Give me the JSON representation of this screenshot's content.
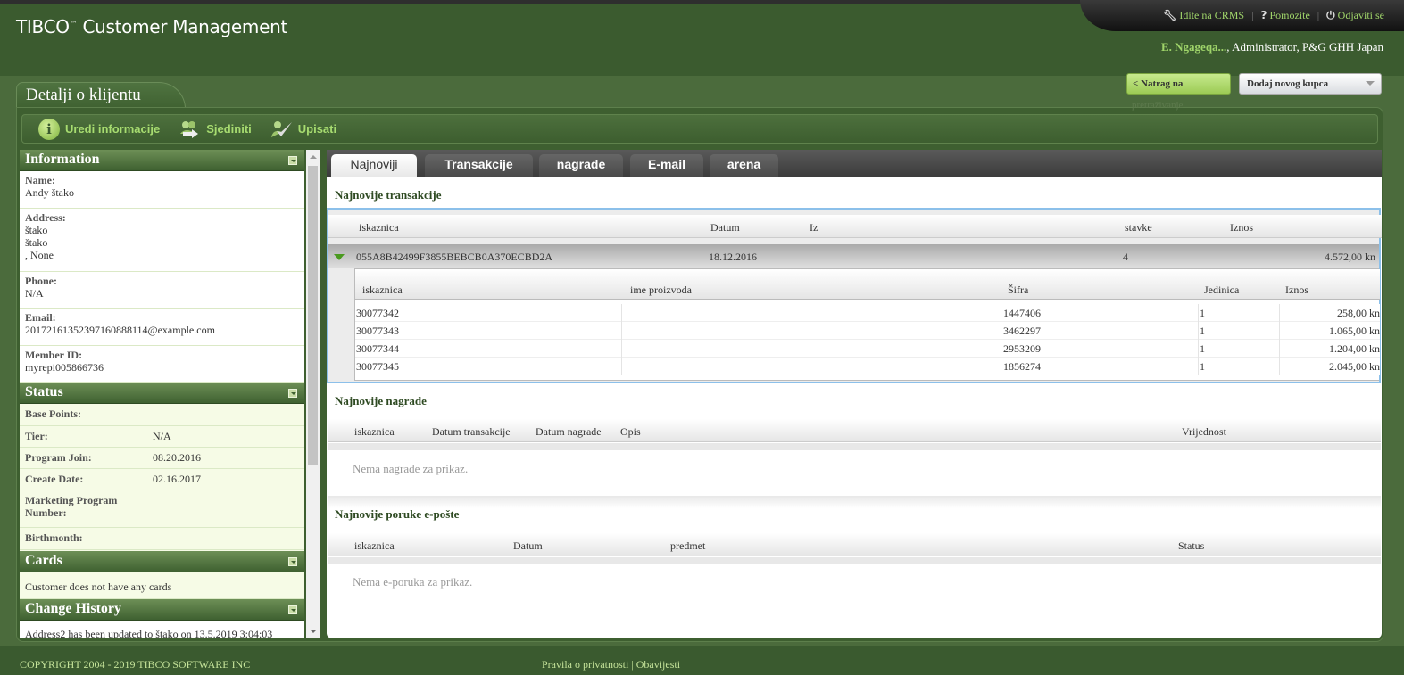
{
  "app": {
    "title": "TIBCO",
    "title_tm": "™",
    "title_rest": " Customer Management"
  },
  "toplinks": {
    "crms": "Idite na CRMS",
    "help": "Pomozite",
    "logout": "Odjaviti se",
    "sep": "|",
    "help_icon": "?",
    "wrench_icon": "wrench-icon",
    "power_icon": "power-icon"
  },
  "user": {
    "name": "E. Ngageqa...",
    "rest": ", Administrator, P&G GHH Japan"
  },
  "nav": {
    "back_label": "< Natrag na",
    "back_overflow": "pretraživanje",
    "add_customer_label": "Dodaj novog kupca"
  },
  "panel": {
    "title": "Detalji o klijentu"
  },
  "toolbar": {
    "edit": "Uredi informacije",
    "merge": "Sjediniti",
    "enroll": "Upisati",
    "info_icon_glyph": "i"
  },
  "information": {
    "header": "Information",
    "fields": [
      {
        "label": "Name:",
        "lines": [
          "Andy štako"
        ]
      },
      {
        "label": "Address:",
        "lines": [
          "štako",
          "štako",
          ", None"
        ]
      },
      {
        "label": "Phone:",
        "lines": [
          "N/A"
        ]
      },
      {
        "label": "Email:",
        "lines": [
          "20172161352397160888114@example.com"
        ]
      },
      {
        "label": "Member ID:",
        "lines": [
          "myrepi005866736"
        ]
      }
    ]
  },
  "status": {
    "header": "Status",
    "rows": [
      {
        "label": "Base Points:",
        "value": ""
      },
      {
        "label": "Tier:",
        "value": "N/A"
      },
      {
        "label": "Program Join:",
        "value": "08.20.2016"
      },
      {
        "label": "Create Date:",
        "value": "02.16.2017"
      },
      {
        "label": "Marketing Program Number:",
        "value": ""
      },
      {
        "label": "Birthmonth:",
        "value": ""
      }
    ]
  },
  "cards": {
    "header": "Cards",
    "text": "Customer does not have any cards"
  },
  "history": {
    "header": "Change History",
    "text": "Address2 has been updated to štako on 13.5.2019 3:04:03"
  },
  "tabs": [
    "Najnoviji",
    "Transakcije",
    "nagrade",
    "E-mail",
    "arena"
  ],
  "transactions": {
    "title": "Najnovije transakcije",
    "columns": [
      "iskaznica",
      "Datum",
      "Iz",
      "stavke",
      "Iznos"
    ],
    "row": {
      "id": "055A8B42499F3855BEBCB0A370ECBD2A",
      "date": "18.12.2016",
      "from": "",
      "items": "4",
      "amount": "4.572,00 kn"
    },
    "sub_columns": [
      "iskaznica",
      "ime proizvoda",
      "Šifra",
      "Jedinica",
      "Iznos"
    ],
    "sub_rows": [
      {
        "card": "30077342",
        "name": "",
        "code": "1447406",
        "unit": "1",
        "amount": "258,00 kn"
      },
      {
        "card": "30077343",
        "name": "",
        "code": "3462297",
        "unit": "1",
        "amount": "1.065,00 kn"
      },
      {
        "card": "30077344",
        "name": "",
        "code": "2953209",
        "unit": "1",
        "amount": "1.204,00 kn"
      },
      {
        "card": "30077345",
        "name": "",
        "code": "1856274",
        "unit": "1",
        "amount": "2.045,00 kn"
      }
    ]
  },
  "rewards": {
    "title": "Najnovije nagrade",
    "columns": [
      "iskaznica",
      "Datum transakcije",
      "Datum nagrade",
      "Opis",
      "Vrijednost"
    ],
    "empty": "Nema nagrade za prikaz."
  },
  "emails": {
    "title": "Najnovije poruke e-pošte",
    "columns": [
      "iskaznica",
      "Datum",
      "predmet",
      "Status"
    ],
    "empty": "Nema e-poruka za prikaz."
  },
  "footer": {
    "copyright": "COPYRIGHT 2004 - 2019 TIBCO SOFTWARE INC",
    "privacy": "Pravila o privatnosti",
    "sep": " | ",
    "notices": "Obavijesti"
  }
}
